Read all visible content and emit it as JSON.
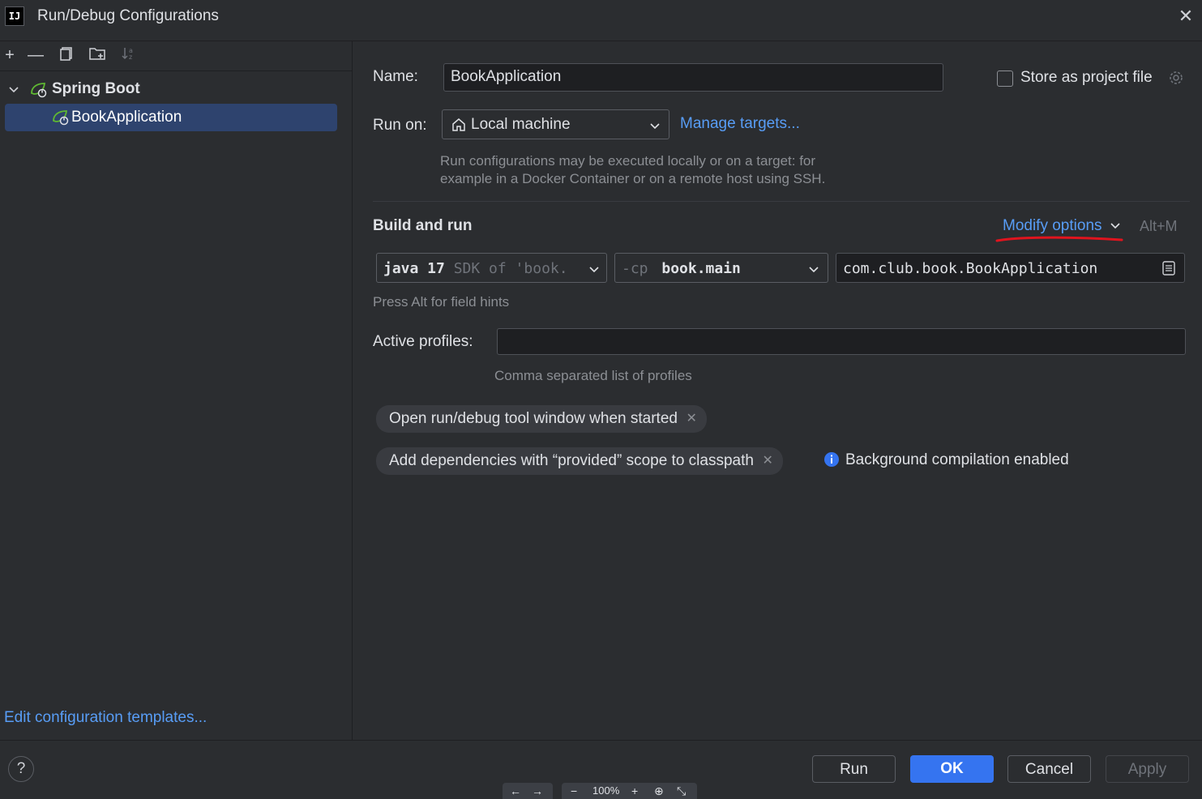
{
  "window": {
    "title": "Run/Debug Configurations",
    "app_icon_text": "IJ"
  },
  "tree": {
    "group_label": "Spring Boot",
    "items": [
      {
        "label": "BookApplication"
      }
    ],
    "edit_templates_link": "Edit configuration templates..."
  },
  "form": {
    "name_label": "Name:",
    "name_value": "BookApplication",
    "store_as_project_file_label": "Store as project file",
    "run_on_label": "Run on:",
    "run_on_value": "Local machine",
    "manage_targets_link": "Manage targets...",
    "run_on_hint_line1": "Run configurations may be executed locally or on a target: for",
    "run_on_hint_line2": "example in a Docker Container or on a remote host using SSH.",
    "build_and_run_label": "Build and run",
    "modify_options_link": "Modify options",
    "modify_options_shortcut": "Alt+M",
    "jdk_value": "java 17",
    "jdk_hint": "SDK of 'book.",
    "cp_prefix": "-cp",
    "cp_value": "book.main",
    "main_class_value": "com.club.book.BookApplication",
    "field_hint": "Press Alt for field hints",
    "active_profiles_label": "Active profiles:",
    "active_profiles_value": "",
    "active_profiles_hint": "Comma separated list of profiles",
    "options": [
      {
        "label": "Open run/debug tool window when started"
      },
      {
        "label": "Add dependencies with “provided” scope to classpath"
      }
    ],
    "info_text": "Background compilation enabled"
  },
  "footer": {
    "help_label": "?",
    "run_label": "Run",
    "ok_label": "OK",
    "cancel_label": "Cancel",
    "apply_label": "Apply",
    "zoom_value": "100%"
  },
  "colors": {
    "accent": "#3574f0",
    "link": "#589df6",
    "annotation": "#e0141e",
    "background": "#2b2d30"
  }
}
